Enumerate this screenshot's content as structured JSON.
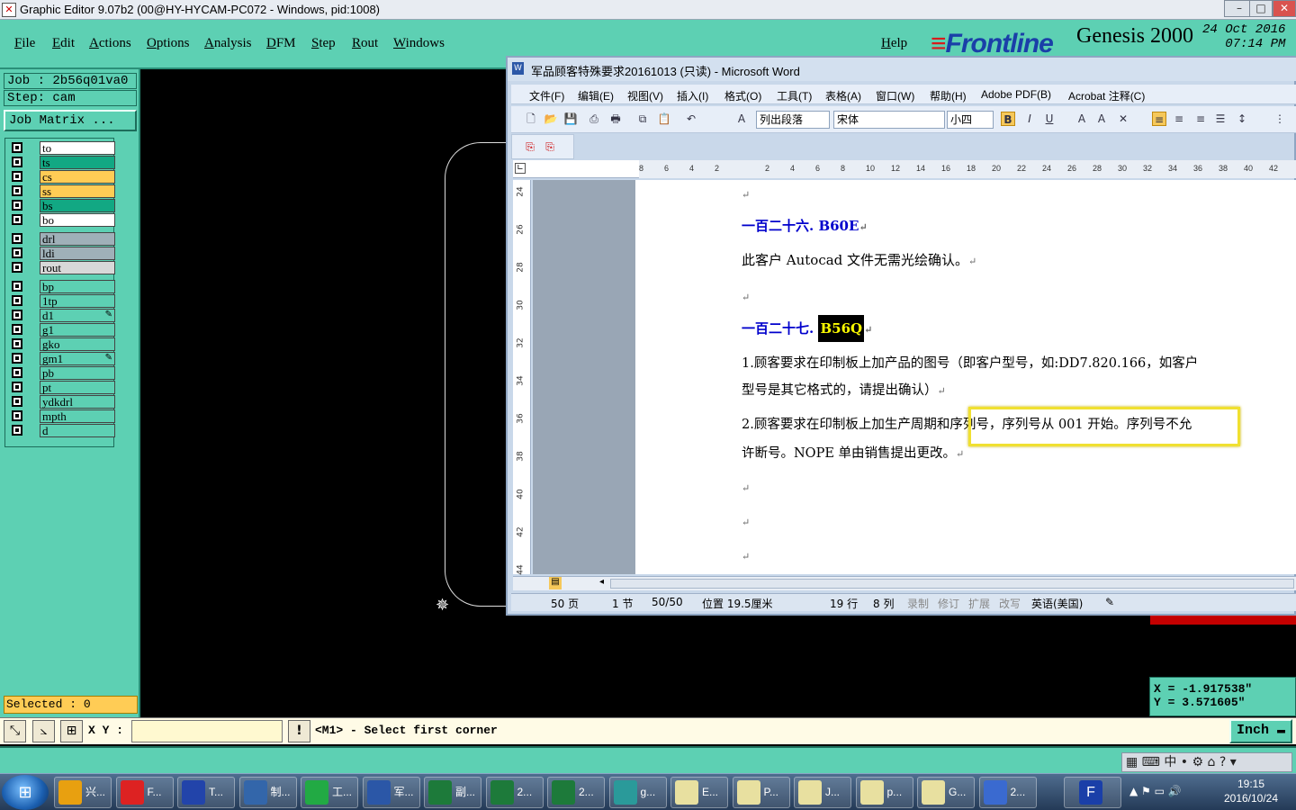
{
  "genesis": {
    "title": "Graphic Editor 9.07b2 (00@HY-HYCAM-PC072 - Windows, pid:1008)",
    "menu": [
      "File",
      "Edit",
      "Actions",
      "Options",
      "Analysis",
      "DFM",
      "Step",
      "Rout",
      "Windows"
    ],
    "help": "Help",
    "brand": {
      "logo": "Frontline",
      "product": "Genesis 2000",
      "date": "24 Oct 2016",
      "time": "07:14 PM"
    },
    "job": "Job : 2b56q01va0",
    "step": "Step: cam",
    "job_matrix": "Job Matrix ...",
    "layers": [
      {
        "name": "to",
        "color": "#ffffff"
      },
      {
        "name": "ts",
        "color": "#12a883"
      },
      {
        "name": "cs",
        "color": "#ffcc55"
      },
      {
        "name": "ss",
        "color": "#ffcc55"
      },
      {
        "name": "bs",
        "color": "#12a883"
      },
      {
        "name": "bo",
        "color": "#ffffff"
      },
      {
        "name": "drl",
        "color": "#9fb0b8"
      },
      {
        "name": "ldi",
        "color": "#9fb0b8"
      },
      {
        "name": "rout",
        "color": "#d8d8d8"
      },
      {
        "name": "bp",
        "color": "#5dd0b3"
      },
      {
        "name": "1tp",
        "color": "#5dd0b3"
      },
      {
        "name": "d1",
        "color": "#5dd0b3"
      },
      {
        "name": "g1",
        "color": "#5dd0b3"
      },
      {
        "name": "gko",
        "color": "#5dd0b3"
      },
      {
        "name": "gm1",
        "color": "#5dd0b3"
      },
      {
        "name": "pb",
        "color": "#5dd0b3"
      },
      {
        "name": "pt",
        "color": "#5dd0b3"
      },
      {
        "name": "ydkdrl",
        "color": "#5dd0b3"
      },
      {
        "name": "mpth",
        "color": "#5dd0b3"
      },
      {
        "name": "d",
        "color": "#5dd0b3"
      }
    ],
    "selected": "Selected : 0",
    "xy_label": "X Y :",
    "prompt": "<M1> - Select first corner",
    "units": "Inch",
    "coord_x": "X = -1.917538\"",
    "coord_y": "Y = 3.571605\""
  },
  "word": {
    "title": "军品顾客特殊要求20161013 (只读) - Microsoft Word",
    "menu": [
      "文件(F)",
      "编辑(E)",
      "视图(V)",
      "插入(I)",
      "格式(O)",
      "工具(T)",
      "表格(A)",
      "窗口(W)",
      "帮助(H)",
      "Adobe PDF(B)",
      "Acrobat 注释(C)"
    ],
    "style": "列出段落",
    "font": "宋体",
    "size": "小四",
    "heading1": "一百二十六. B60E",
    "line1": "此客户 Autocad 文件无需光绘确认。",
    "heading2_prefix": "一百二十七.",
    "heading2_code": "B56Q",
    "item1a": "1.顾客要求在印制板上加产品的图号（即客户型号，如:DD7.820.166，如客户",
    "item1b": "型号是其它格式的，请提出确认）",
    "item2a": "2.顾客要求在印制板上加生产周期和序列号，序列号从 001 开始。序列号不允",
    "item2b": "许断号。NOPE 单由销售提出更改。",
    "status": {
      "page": "50 页",
      "section": "1 节",
      "pages": "50/50",
      "pos": "位置 19.5厘米",
      "line": "19 行",
      "col": "8 列",
      "rec": "录制",
      "rev": "修订",
      "ext": "扩展",
      "ovr": "改写",
      "lang": "英语(美国)"
    }
  },
  "taskbar": {
    "items": [
      "兴...",
      "F...",
      "T...",
      "制...",
      "工...",
      "军...",
      "副...",
      "2...",
      "2...",
      "g...",
      "E...",
      "P...",
      "J...",
      "p...",
      "G...",
      "2..."
    ],
    "time": "19:15",
    "date": "2016/10/24",
    "ime": "中"
  }
}
